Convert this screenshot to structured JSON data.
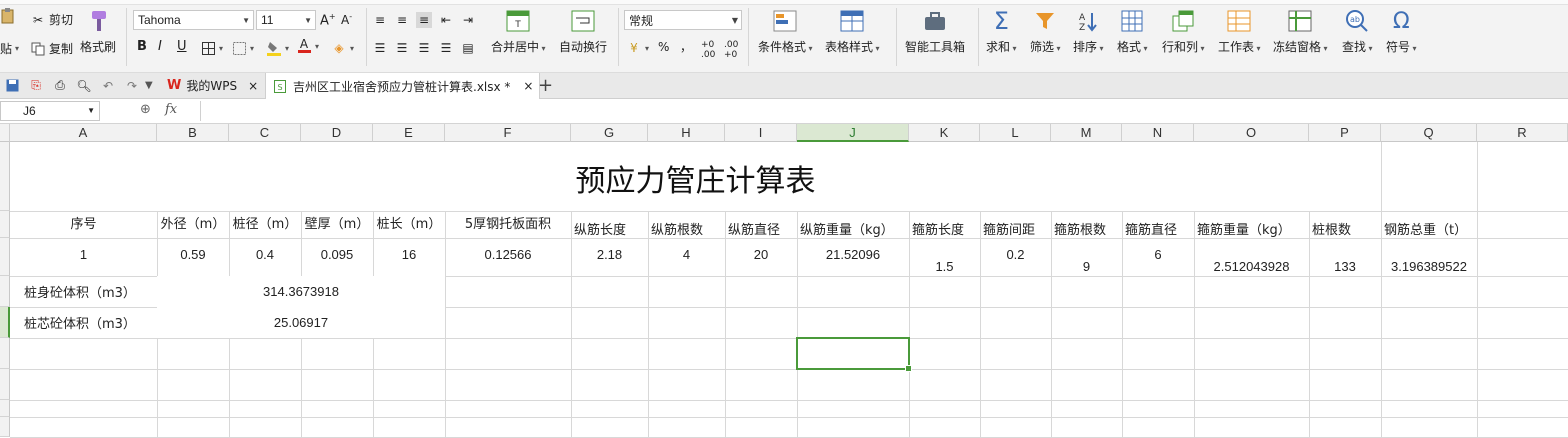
{
  "ribbon": {
    "paste_label": "贴",
    "cut_label": "剪切",
    "copy_label": "复制",
    "format_painter_label": "格式刷",
    "font_name": "Tahoma",
    "font_size": "11",
    "merge_center_label": "合并居中",
    "wrap_text_label": "自动换行",
    "number_format": "常规",
    "percent_symbol": "%",
    "comma_symbol": "，",
    "cond_format_label": "条件格式",
    "table_style_label": "表格样式",
    "smart_toolbox_label": "智能工具箱",
    "sum_label": "求和",
    "filter_label": "筛选",
    "sort_label": "排序",
    "format_label": "格式",
    "rowcol_label": "行和列",
    "worksheet_label": "工作表",
    "freeze_label": "冻结窗格",
    "find_label": "查找",
    "symbol_label": "符号",
    "bold": "B",
    "italic": "I",
    "underline": "U"
  },
  "tabs": {
    "my_wps": "我的WPS",
    "file_tab": "吉州区工业宿舍预应力管桩计算表.xlsx *"
  },
  "formula_bar": {
    "cell_ref": "J6",
    "fx": "fx",
    "content": ""
  },
  "columns": [
    "A",
    "B",
    "C",
    "D",
    "E",
    "F",
    "G",
    "H",
    "I",
    "J",
    "K",
    "L",
    "M",
    "N",
    "O",
    "P",
    "Q",
    "R"
  ],
  "selected_column": "J",
  "sheet": {
    "title": "预应力管庄计算表",
    "headers": [
      "序号",
      "外径（m）",
      "桩径（m）",
      "壁厚（m）",
      "桩长（m）",
      "5厚钢托板面积",
      "纵筋长度",
      "纵筋根数",
      "纵筋直径",
      "纵筋重量（kg）",
      "箍筋长度",
      "箍筋间距",
      "箍筋根数",
      "箍筋直径",
      "箍筋重量（kg）",
      "桩根数",
      "钢筋总重（t）"
    ],
    "row1": [
      "1",
      "0.59",
      "0.4",
      "0.095",
      "16",
      "0.12566",
      "2.18",
      "4",
      "20",
      "21.52096",
      "1.5",
      "0.2",
      "9",
      "6",
      "2.512043928",
      "133",
      "3.196389522"
    ],
    "pile_body_label": "桩身砼体积（m3）",
    "pile_body_value": "314.3673918",
    "pile_core_label": "桩芯砼体积（m3）",
    "pile_core_value": "25.06917"
  },
  "colors": {
    "accent_green": "#4a9a3a",
    "wps_red": "#d9251d",
    "icon_blue": "#3f6fb5",
    "icon_orange": "#e8952a"
  }
}
